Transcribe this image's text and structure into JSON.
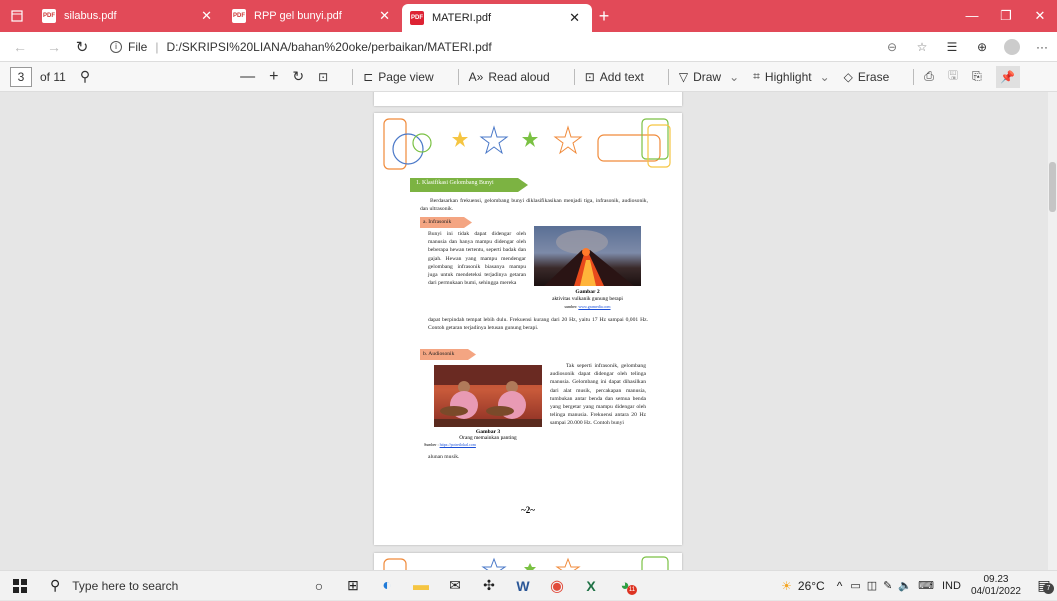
{
  "tabs": [
    {
      "label": "silabus.pdf"
    },
    {
      "label": "RPP gel bunyi.pdf"
    },
    {
      "label": "MATERI.pdf"
    }
  ],
  "address": {
    "scheme": "File",
    "url": "D:/SKRIPSI%20LIANA/bahan%20oke/perbaikan/MATERI.pdf"
  },
  "toolbar": {
    "page_current": "3",
    "page_total": "of 11",
    "page_view": "Page view",
    "read_aloud": "Read aloud",
    "add_text": "Add text",
    "draw": "Draw",
    "highlight": "Highlight",
    "erase": "Erase"
  },
  "document": {
    "section_title": "1.  Klasifikasi Gelombang Bunyi",
    "intro": "Berdasarkan frekuensi, gelombang bunyi diklasifikasikan menjadi tiga, infrasonik, audiosonik, dan ultrasonik.",
    "sub_a": "a.  Infrasonik",
    "infra_text": "Bunyi ini tidak dapat didengar oleh manusia dan hanya mampu didengar oleh beberapa hewan tertentu, seperti badak dan gajah. Hewan yang mampu mendengar gelombang infrasonik biasanya mampu juga untuk mendeteksi terjadinya getaran dari permukaan bumi, sehingga mereka",
    "infra_cont": "dapat berpindah tempat lebih dulu. Frekuensi kurang dari 20 Hz, yaitu 17 Hz sampai 0,001 Hz. Contoh getaran terjadinya letusan gunung berapi.",
    "fig2_title": "Gambar 2",
    "fig2_caption": "aktivitas vulkanik gunung berapi",
    "fig2_source_label": "sumber:",
    "fig2_source": "www.gramedia.com",
    "sub_b": "b.  Audiosonik",
    "audio_text": "Tak seperti infrasonik, gelombang audiosonik dapat didengar oleh telinga manusia. Gelombang ini dapat dihasilkan dari alat musik, percakapan manusia, tumbukan antar benda dan semua benda yang bergetar yang mampu didengar oleh telinga manusia. Frekuensi antara 20 Hz sampai 20.000 Hz. Contoh bunyi",
    "audio_cont": "alunan musik.",
    "fig3_title": "Gambar 3",
    "fig3_caption": "Orang memainkan panting",
    "fig3_source_label": "Sumber :",
    "fig3_source": "https://potretlokal.com",
    "page_number": "~2~"
  },
  "taskbar": {
    "search_placeholder": "Type here to search",
    "weather": "26°C",
    "lang": "IND",
    "time": "09.23",
    "date": "04/01/2022",
    "notif_count": "7",
    "chrome_badge": "11"
  },
  "colors": {
    "tabbar": "#e24a58",
    "section_arrow": "#7cb342",
    "sub_tag": "#f4a582",
    "link": "#1a4fd8"
  }
}
